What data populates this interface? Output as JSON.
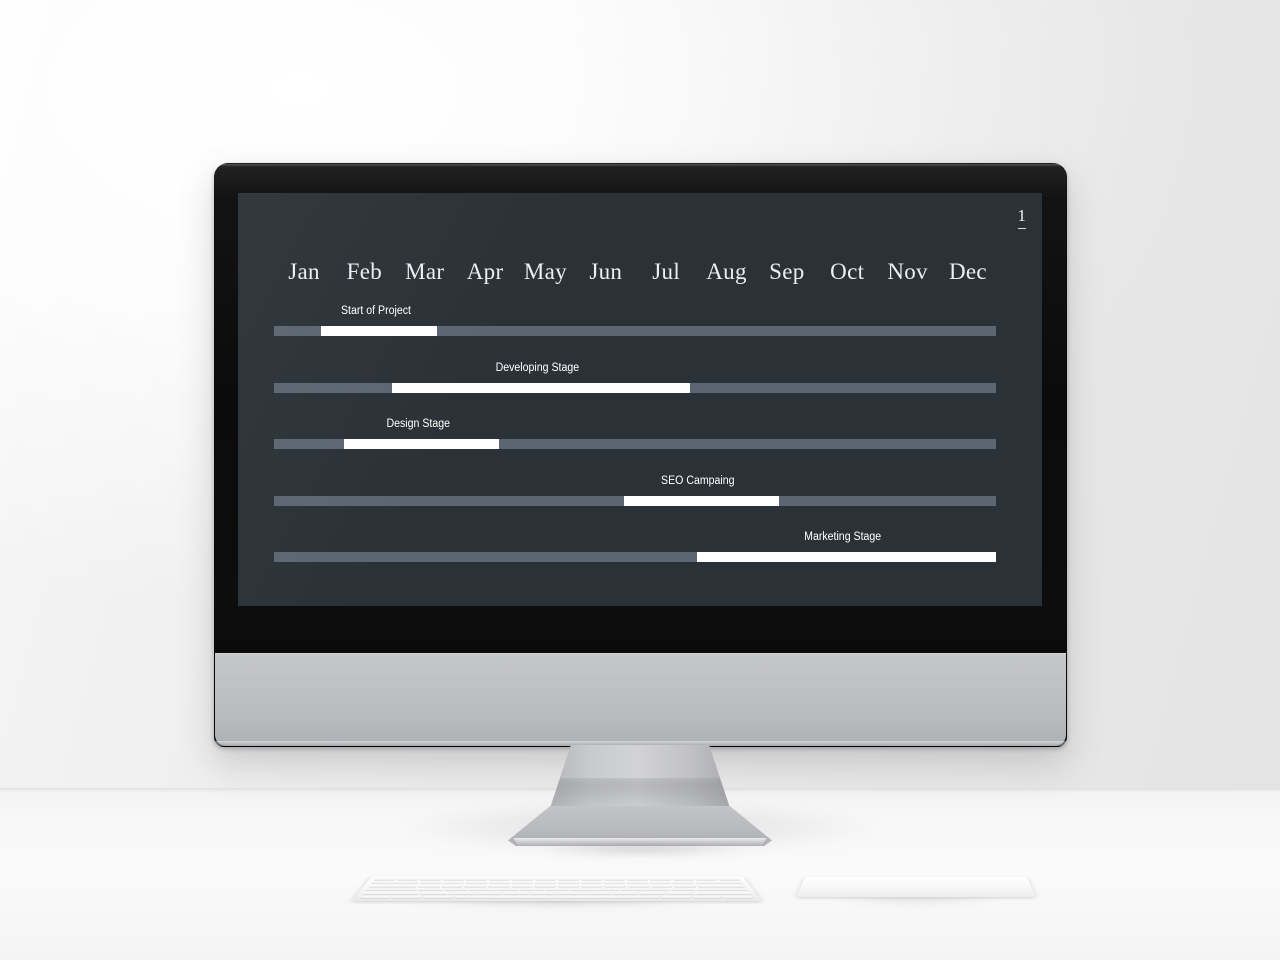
{
  "scene": {
    "device": "desktop-computer-mockup",
    "keyboard": "wireless-keyboard",
    "trackpad": "trackpad"
  },
  "slide": {
    "page_number": "1",
    "background_color": "#2b3237",
    "track_color": "#5b6672",
    "fill_color": "#ffffff",
    "text_color": "#ffffff"
  },
  "chart_data": {
    "type": "bar",
    "title": "",
    "subtitle": "",
    "xlabel": "",
    "ylabel": "",
    "grid": false,
    "legend": null,
    "orientation": "horizontal",
    "axis_unit": "month",
    "categories": [
      "Jan",
      "Feb",
      "Mar",
      "Apr",
      "May",
      "Jun",
      "Jul",
      "Aug",
      "Sep",
      "Oct",
      "Nov",
      "Dec"
    ],
    "xlim": [
      0,
      12
    ],
    "tasks": [
      {
        "name": "Start of Project",
        "start_month": 0.78,
        "end_month": 2.71,
        "start_label": "Jan",
        "end_label": "Mar"
      },
      {
        "name": "Developing Stage",
        "start_month": 1.96,
        "end_month": 6.91,
        "start_label": "Feb",
        "end_label": "Jul"
      },
      {
        "name": "Design Stage",
        "start_month": 1.16,
        "end_month": 3.74,
        "start_label": "Feb",
        "end_label": "Apr"
      },
      {
        "name": "SEO Campaing",
        "start_month": 5.81,
        "end_month": 8.39,
        "start_label": "Jun",
        "end_label": "Sep"
      },
      {
        "name": "Marketing Stage",
        "start_month": 7.03,
        "end_month": 12.0,
        "start_label": "Aug",
        "end_label": "Dec"
      }
    ]
  }
}
